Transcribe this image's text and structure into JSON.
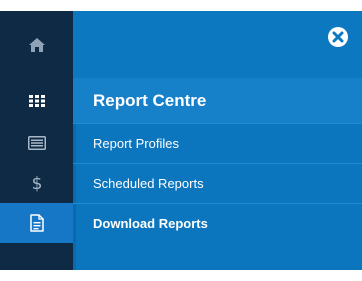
{
  "rail": {
    "items": [
      {
        "icon": "home-icon",
        "active": false
      },
      {
        "icon": "grid-icon",
        "active": false
      },
      {
        "icon": "list-icon",
        "active": false
      },
      {
        "icon": "dollar-icon",
        "active": false
      },
      {
        "icon": "document-icon",
        "active": true
      }
    ]
  },
  "panel": {
    "title": "Report Centre",
    "close_icon": "close-circle-icon",
    "items": [
      {
        "label": "Report Profiles",
        "bold": false
      },
      {
        "label": "Scheduled Reports",
        "bold": false
      },
      {
        "label": "Download Reports",
        "bold": true
      }
    ]
  },
  "colors": {
    "rail_bg": "#0e2a45",
    "rail_active": "#1677c7",
    "panel_bg": "#0b75bd",
    "title_bg": "#1680c9"
  }
}
